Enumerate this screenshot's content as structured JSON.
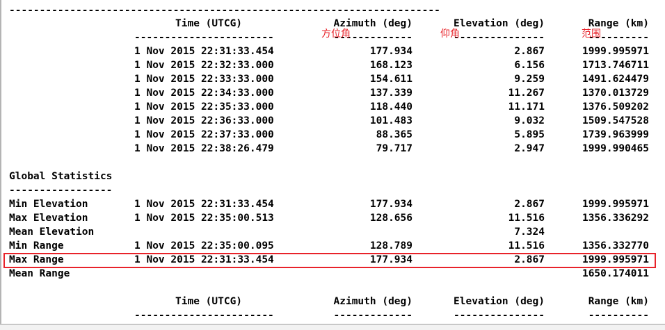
{
  "report": {
    "top_rule": "-----------------------------------------------------------------------",
    "header": {
      "time": "Time (UTCG)",
      "azimuth": "Azimuth (deg)",
      "elevation": "Elevation (deg)",
      "range": "Range (km)"
    },
    "header_rules": {
      "time": "-----------------------",
      "azimuth": "-------------",
      "elevation": "---------------",
      "range": "----------"
    },
    "annotations": {
      "azimuth": "方位角",
      "elevation": "仰角",
      "range": "范围"
    },
    "rows": [
      {
        "time": "1 Nov 2015 22:31:33.454",
        "azimuth": "177.934",
        "elevation": "2.867",
        "range": "1999.995971"
      },
      {
        "time": "1 Nov 2015 22:32:33.000",
        "azimuth": "168.123",
        "elevation": "6.156",
        "range": "1713.746711"
      },
      {
        "time": "1 Nov 2015 22:33:33.000",
        "azimuth": "154.611",
        "elevation": "9.259",
        "range": "1491.624479"
      },
      {
        "time": "1 Nov 2015 22:34:33.000",
        "azimuth": "137.339",
        "elevation": "11.267",
        "range": "1370.013729"
      },
      {
        "time": "1 Nov 2015 22:35:33.000",
        "azimuth": "118.440",
        "elevation": "11.171",
        "range": "1376.509202"
      },
      {
        "time": "1 Nov 2015 22:36:33.000",
        "azimuth": "101.483",
        "elevation": "9.032",
        "range": "1509.547528"
      },
      {
        "time": "1 Nov 2015 22:37:33.000",
        "azimuth": "88.365",
        "elevation": "5.895",
        "range": "1739.963999"
      },
      {
        "time": "1 Nov 2015 22:38:26.479",
        "azimuth": "79.717",
        "elevation": "2.947",
        "range": "1999.990465"
      }
    ],
    "global_statistics": {
      "title": "Global Statistics",
      "title_rule": "-----------------",
      "rows": [
        {
          "label": "Min Elevation",
          "time": "1 Nov 2015 22:31:33.454",
          "azimuth": "177.934",
          "elevation": "2.867",
          "range": "1999.995971"
        },
        {
          "label": "Max Elevation",
          "time": "1 Nov 2015 22:35:00.513",
          "azimuth": "128.656",
          "elevation": "11.516",
          "range": "1356.336292"
        },
        {
          "label": "Mean Elevation",
          "time": "",
          "azimuth": "",
          "elevation": "7.324",
          "range": ""
        },
        {
          "label": "Min Range",
          "time": "1 Nov 2015 22:35:00.095",
          "azimuth": "128.789",
          "elevation": "11.516",
          "range": "1356.332770"
        },
        {
          "label": "Max Range",
          "time": "1 Nov 2015 22:31:33.454",
          "azimuth": "177.934",
          "elevation": "2.867",
          "range": "1999.995971"
        },
        {
          "label": "Mean Range",
          "time": "",
          "azimuth": "",
          "elevation": "",
          "range": "1650.174011"
        }
      ]
    },
    "highlight_color": "#e8232a"
  }
}
